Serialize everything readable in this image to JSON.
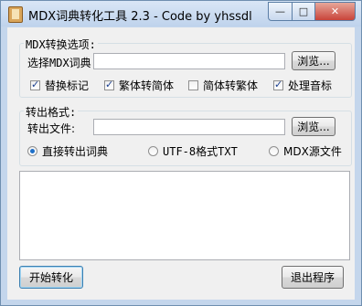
{
  "window": {
    "title": "MDX词典转化工具 2.3 - Code by yhssdl",
    "minimize_glyph": "—",
    "maximize_glyph": "□",
    "close_glyph": "✕",
    "app_icon": "book-icon"
  },
  "convert_options": {
    "group_title": "MDX转换选项:",
    "select_label": "选择MDX词典",
    "select_value": "",
    "browse_label": "浏览...",
    "checkboxes": [
      {
        "label": "替换标记",
        "checked": true
      },
      {
        "label": "繁体转简体",
        "checked": true
      },
      {
        "label": "简体转繁体",
        "checked": false
      },
      {
        "label": "处理音标",
        "checked": true
      }
    ]
  },
  "output_format": {
    "group_title": "转出格式:",
    "file_label": "转出文件:",
    "file_value": "",
    "browse_label": "浏览...",
    "radios": [
      {
        "label": "直接转出词典",
        "selected": true
      },
      {
        "label": "UTF-8格式TXT",
        "selected": false
      },
      {
        "label": "MDX源文件",
        "selected": false
      }
    ]
  },
  "log": {
    "text": ""
  },
  "footer": {
    "start_label": "开始转化",
    "exit_label": "退出程序"
  }
}
